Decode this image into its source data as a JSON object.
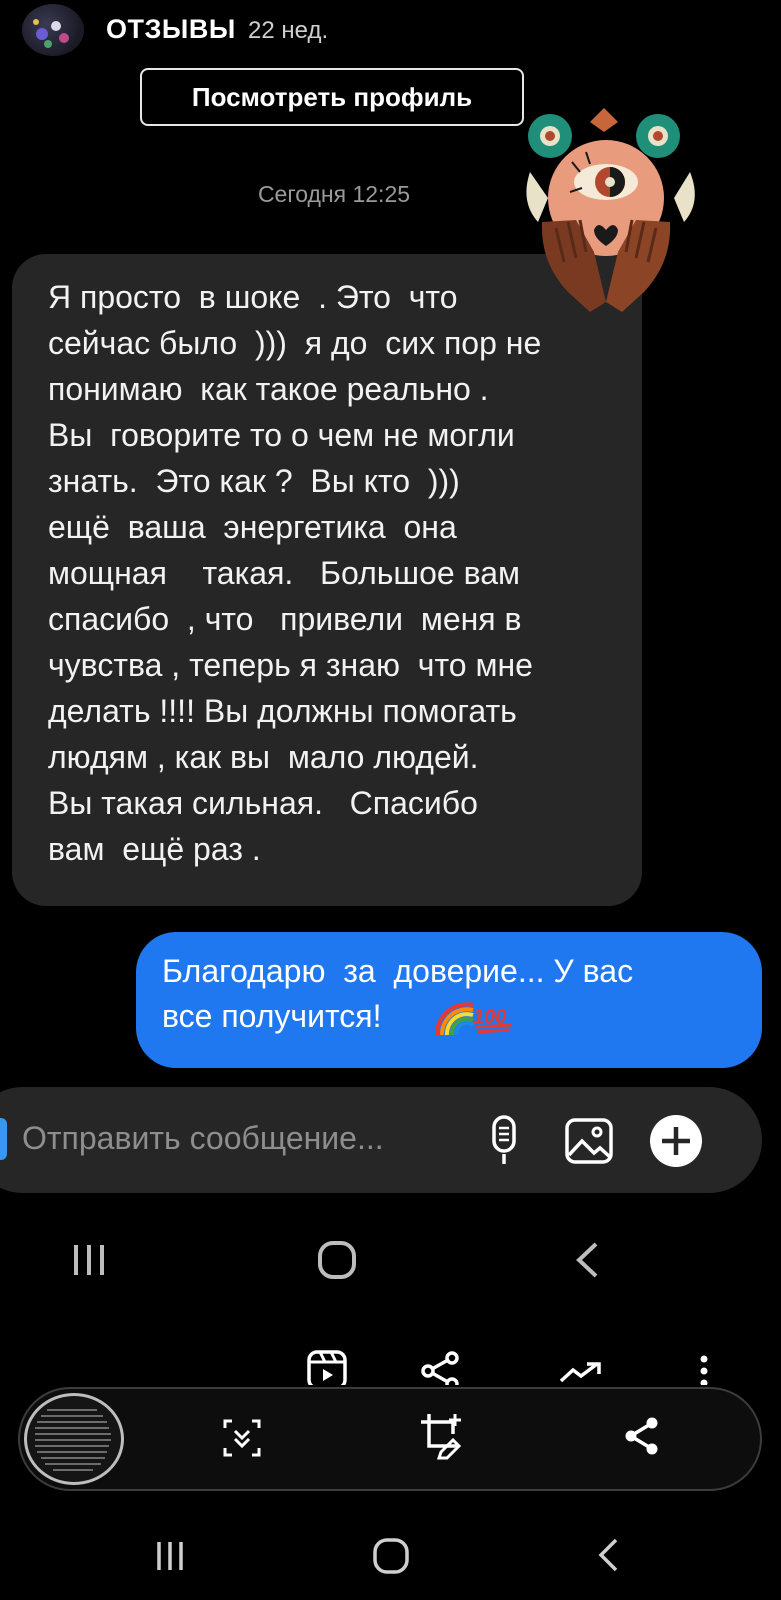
{
  "header": {
    "title": "ОТЗЫВЫ",
    "time": "22 нед."
  },
  "profile_button": {
    "label": "Посмотреть профиль"
  },
  "conversation": {
    "date_label": "Сегодня 12:25",
    "incoming_lines": [
      "Я просто  в шоке  . Это  что",
      "сейчас было  )))  я до  сих пор не",
      "понимаю  как такое реально .",
      "Вы  говорите то о чем не могли",
      "знать.  Это как ?  Вы кто  )))",
      "ещё  ваша  энергетика  она",
      "мощная    такая.   Большое вам",
      "спасибо  , что   привели  меня в",
      "чувства , теперь я знаю  что мне",
      "делать !!!! Вы должны помогать",
      "людям , как вы  мало людей.",
      "Вы такая сильная.   Спасибо",
      "вам  ещё раз ."
    ],
    "outgoing_lines": [
      "Благодарю  за  доверие... У вас",
      "все получится!"
    ]
  },
  "composer": {
    "placeholder": "Отправить сообщение...",
    "icons": [
      "microphone-icon",
      "gallery-icon",
      "add-icon"
    ]
  },
  "system_nav": {
    "icons": [
      "recents-icon",
      "home-icon",
      "back-icon"
    ]
  },
  "share_row": {
    "icons": [
      "reels-icon",
      "share-icon",
      "trending-icon",
      "more-icon"
    ]
  },
  "screenshot_toolbar": {
    "icons": [
      "scroll-capture-icon",
      "crop-edit-icon",
      "share-icon"
    ]
  },
  "colors": {
    "background": "#000000",
    "incoming_bubble": "#262626",
    "outgoing_bubble": "#1f78f0",
    "composer": "#262626"
  }
}
